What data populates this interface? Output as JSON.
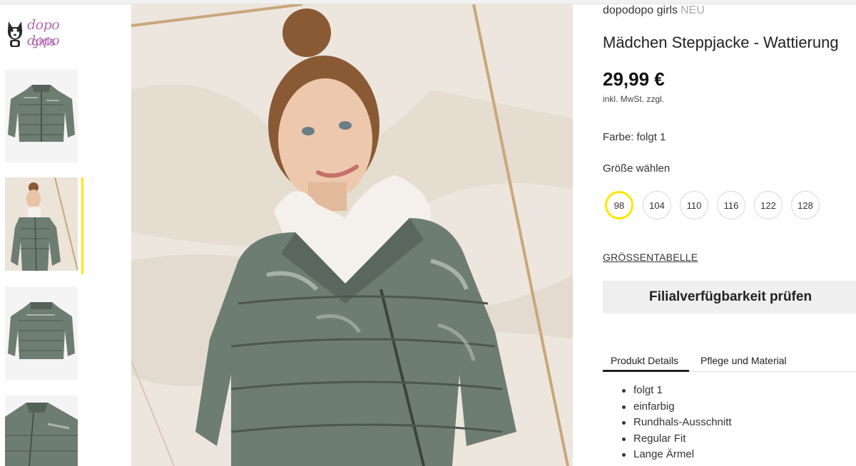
{
  "brand_logo": {
    "script": "dopo dopo",
    "sub": "girls"
  },
  "thumbnails": [
    {
      "name": "jacket-front"
    },
    {
      "name": "model-wearing-jacket",
      "active": true
    },
    {
      "name": "jacket-back"
    },
    {
      "name": "jacket-detail"
    }
  ],
  "product": {
    "brand": "dopodopo girls",
    "badge": "NEU",
    "title": "Mädchen Steppjacke - Wattierung",
    "price": "29,99 €",
    "tax_note": "inkl. MwSt. zzgl.",
    "color_line": "Farbe: folgt 1",
    "size_heading": "Größe wählen",
    "sizes": [
      "98",
      "104",
      "110",
      "116",
      "122",
      "128"
    ],
    "selected_size": "98",
    "size_chart_link": "GRÖSSENTABELLE",
    "availability_button": "Filialverfügbarkeit prüfen"
  },
  "tabs": [
    {
      "label": "Produkt Details",
      "active": true
    },
    {
      "label": "Pflege und Material",
      "active": false
    }
  ],
  "details": [
    "folgt 1",
    "einfarbig",
    "Rundhals-Ausschnitt",
    "Regular Fit",
    "Lange Ärmel"
  ],
  "colors": {
    "accent_yellow": "#ffe600",
    "jacket_green": "#6e7d72",
    "logo_purple": "#b06ab3"
  }
}
